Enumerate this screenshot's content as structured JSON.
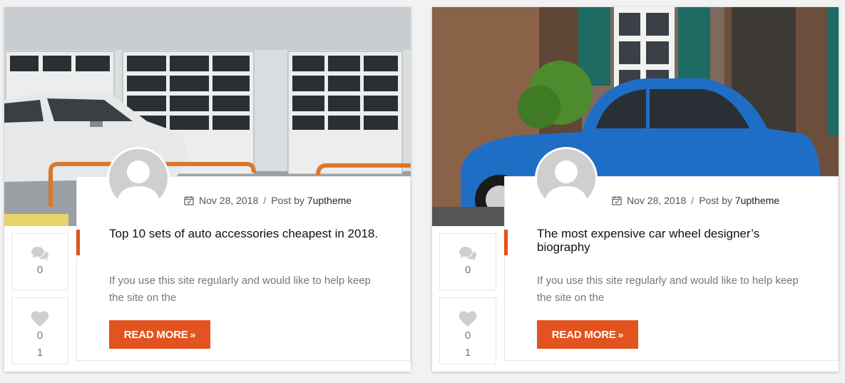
{
  "posts": [
    {
      "date": "Nov 28, 2018",
      "separator": "/",
      "post_by": "Post by",
      "author": "7uptheme",
      "title": "Top 10 sets of auto accessories cheapest in 2018.",
      "excerpt": "If you use this site regularly and would like to help keep the site on the",
      "read_more": "READ MORE",
      "read_more_arrow": "»",
      "comments": "0",
      "likes": "0",
      "likes_extra": "1",
      "image_icon": "garage-white-car-photo"
    },
    {
      "date": "Nov 28, 2018",
      "separator": "/",
      "post_by": "Post by",
      "author": "7uptheme",
      "title": "The most expensive car wheel designer’s biography",
      "excerpt": "If you use this site regularly and would like to help keep the site on the",
      "read_more": "READ MORE",
      "read_more_arrow": "»",
      "comments": "0",
      "likes": "0",
      "likes_extra": "1",
      "image_icon": "blue-vintage-car-photo"
    }
  ],
  "colors": {
    "accent": "#e3531f",
    "card_bg": "#ffffff",
    "page_bg": "#f2f2f2"
  }
}
